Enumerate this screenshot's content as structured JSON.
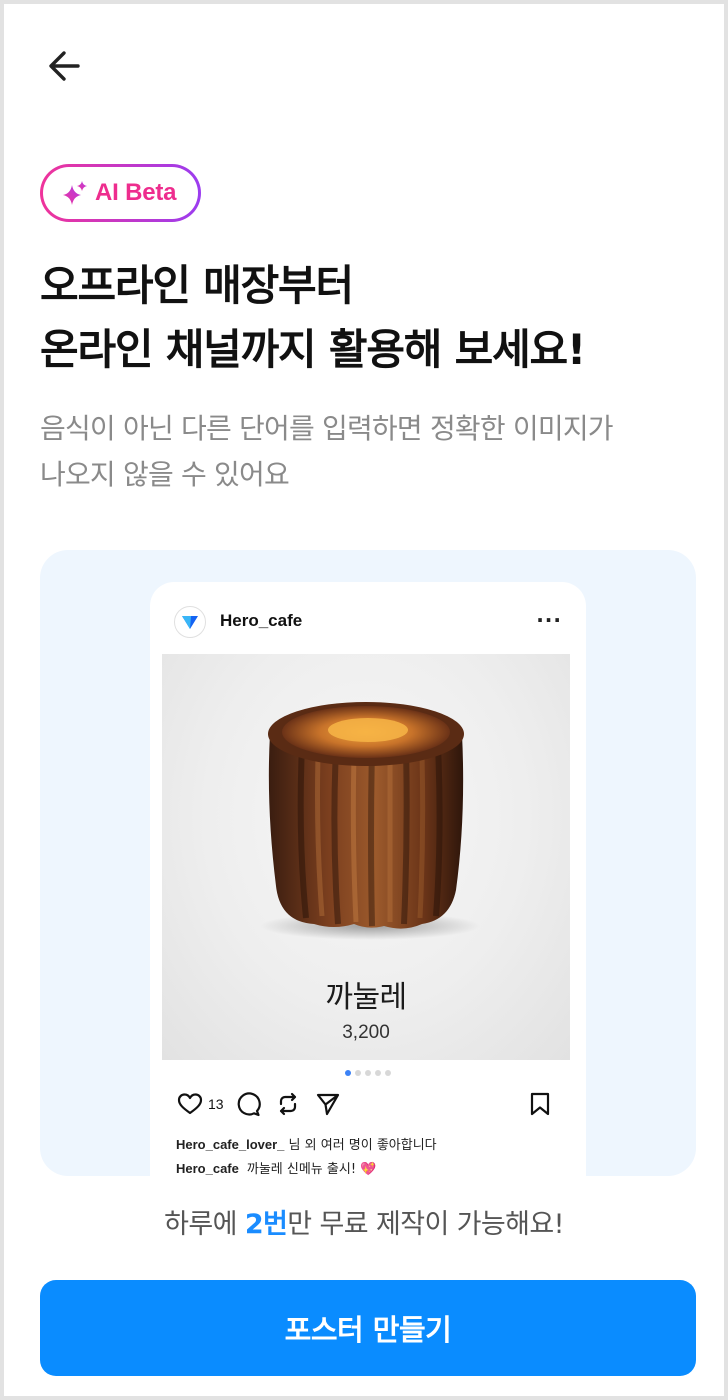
{
  "header": {
    "back_icon": "arrow-left-icon"
  },
  "badge": {
    "icon": "sparkle-icon",
    "label": "AI Beta",
    "gradient": [
      "#f0339a",
      "#9b3cf0"
    ]
  },
  "headline": {
    "line1": "오프라인 매장부터",
    "line2": "온라인 채널까지 활용해 보세요!"
  },
  "subtext": {
    "line1": "음식이 아닌 다른 단어를 입력하면 정확한 이미지가",
    "line2": "나오지 않을 수 있어요"
  },
  "preview": {
    "background": "#eef6fe",
    "post": {
      "username": "Hero_cafe",
      "more_label": "···",
      "product_name": "까눌레",
      "product_price": "3,200",
      "carousel_dots": 5,
      "active_dot": 0,
      "like_count": "13",
      "liked_by_user": "Hero_cafe_lover_",
      "liked_by_suffix": "님 외 여러 명이 좋아합니다",
      "caption_user": "Hero_cafe",
      "caption_text": "까눌레 신메뉴 출시! 💖"
    }
  },
  "limit_note": {
    "prefix": "하루에 ",
    "highlight": "2번",
    "suffix": "만 무료 제작이 가능해요!",
    "highlight_color": "#1a8cff"
  },
  "cta": {
    "label": "포스터 만들기",
    "color": "#0a8cff"
  }
}
